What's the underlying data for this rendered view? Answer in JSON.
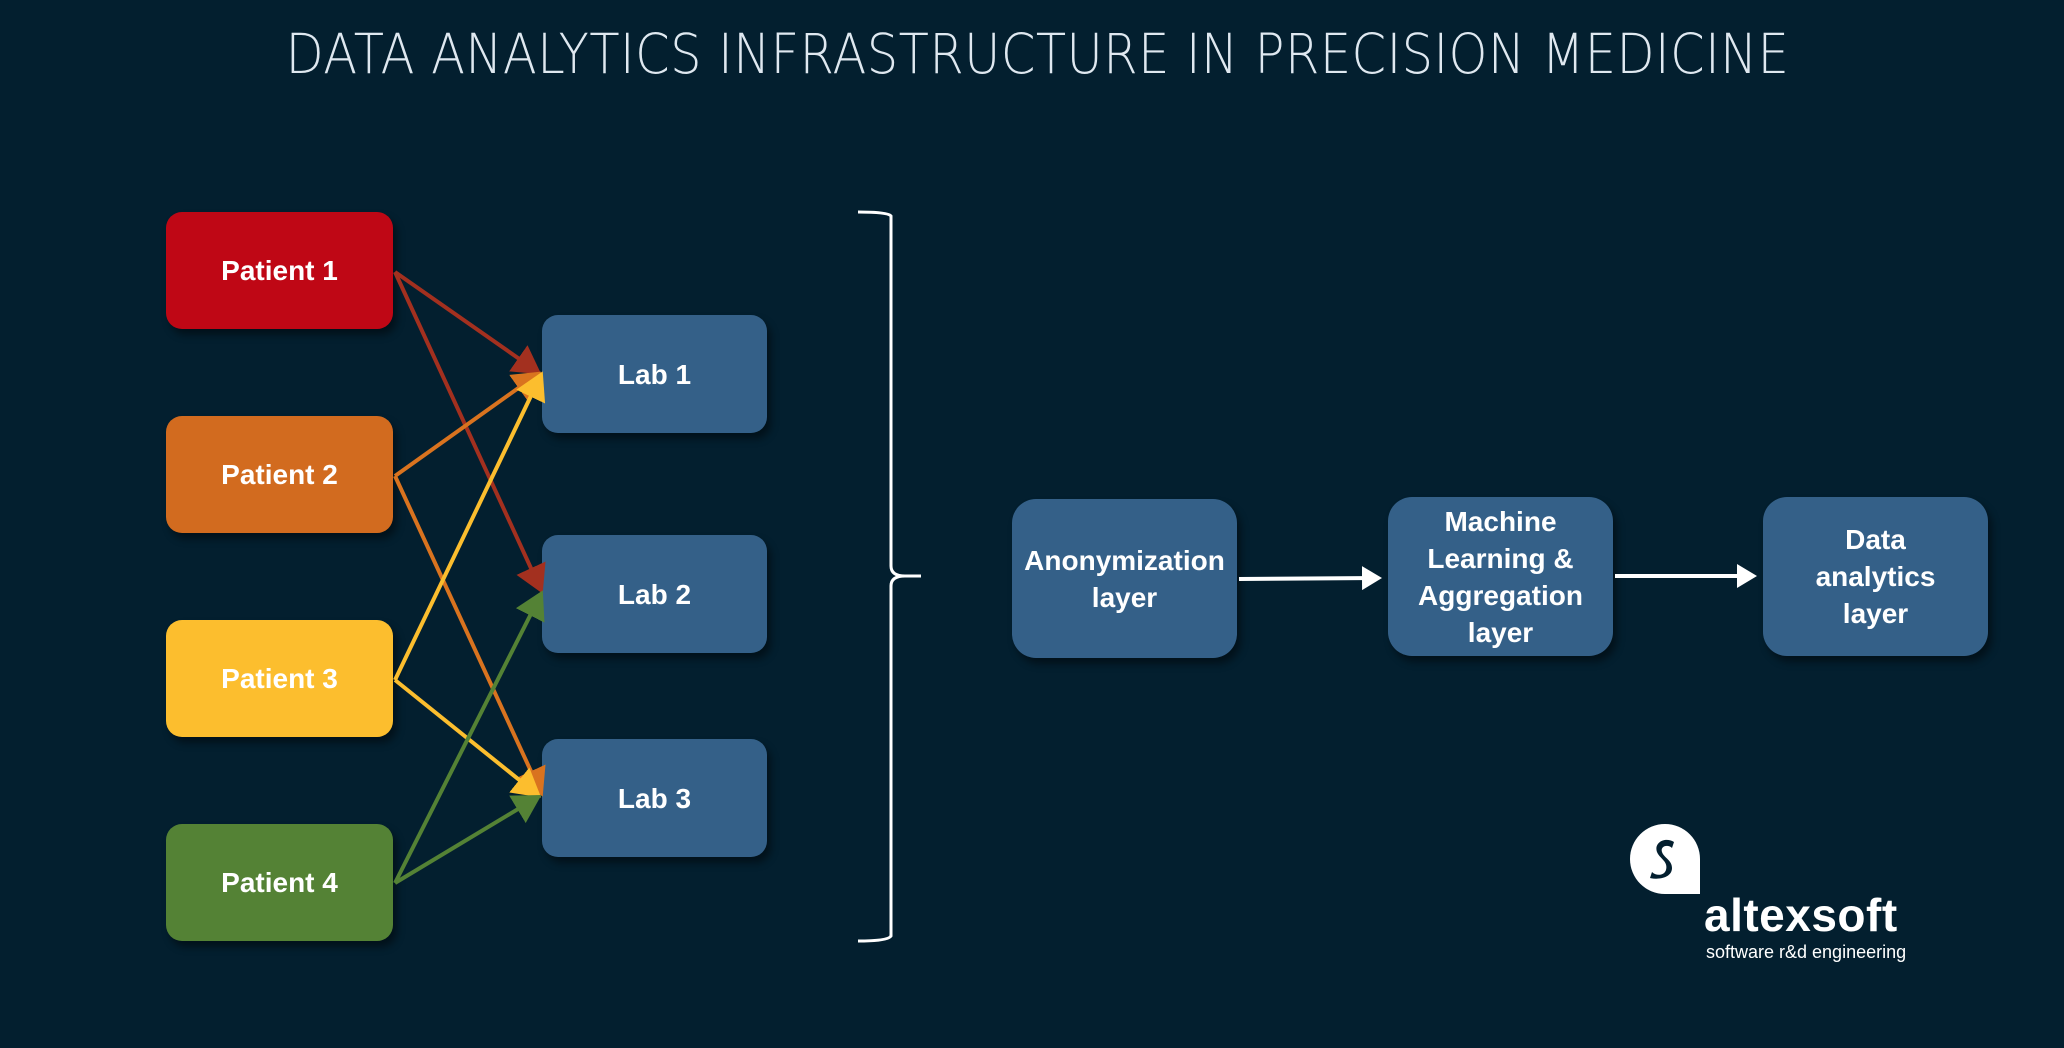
{
  "title": "DATA ANALYTICS INFRASTRUCTURE IN PRECISION MEDICINE",
  "patients": [
    {
      "label": "Patient 1",
      "color": "#bf0715",
      "arrow_color": "#a3301f",
      "targets": [
        "Lab 1",
        "Lab 2"
      ]
    },
    {
      "label": "Patient 2",
      "color": "#d26b1f",
      "arrow_color": "#d9731f",
      "targets": [
        "Lab 1",
        "Lab 3"
      ]
    },
    {
      "label": "Patient 3",
      "color": "#fcbe2e",
      "arrow_color": "#fcbe2e",
      "targets": [
        "Lab 1",
        "Lab 3"
      ]
    },
    {
      "label": "Patient 4",
      "color": "#548235",
      "arrow_color": "#548235",
      "targets": [
        "Lab 2",
        "Lab 3"
      ]
    }
  ],
  "labs": [
    {
      "label": "Lab 1"
    },
    {
      "label": "Lab 2"
    },
    {
      "label": "Lab 3"
    }
  ],
  "pipeline": [
    {
      "label": "Anonymization layer"
    },
    {
      "label": "Machine Learning & Aggregation layer"
    },
    {
      "label": "Data analytics layer"
    }
  ],
  "colors": {
    "background": "#031f2f",
    "box": "#346088",
    "line": "#ffffff"
  },
  "logo": {
    "name": "altexsoft",
    "tagline": "software r&d engineering",
    "icon": "speech-bubble-s-icon"
  }
}
